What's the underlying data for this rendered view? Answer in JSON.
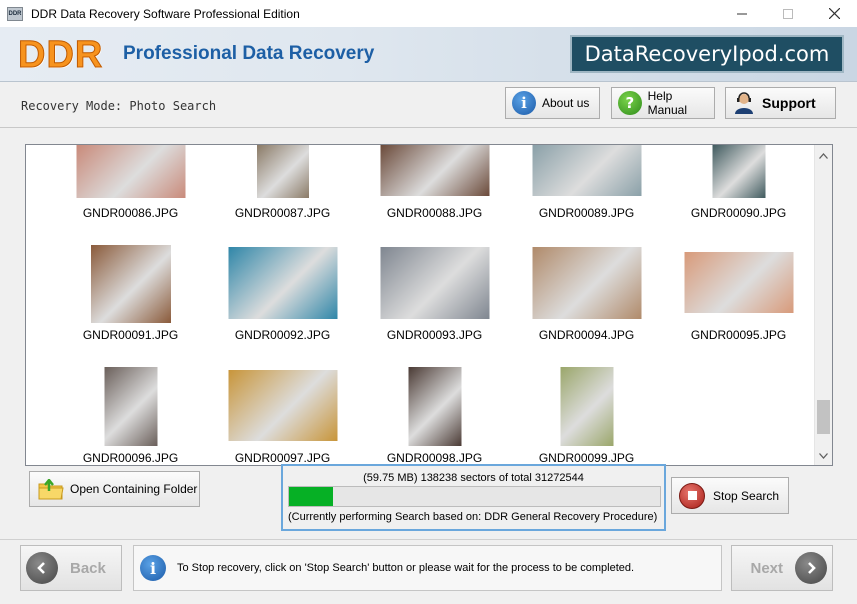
{
  "window": {
    "title": "DDR Data Recovery Software Professional Edition",
    "app_icon_text": "DDR"
  },
  "banner": {
    "logo": "DDR",
    "title": "Professional Data Recovery",
    "site": "DataRecoveryIpod.com"
  },
  "mode": {
    "label": "Recovery Mode: Photo Search"
  },
  "toolbar": {
    "about_label": "About us",
    "help_label": "Help Manual",
    "support_label": "Support"
  },
  "files": [
    {
      "name": "GNDR00086.JPG",
      "color": "#c98a7a"
    },
    {
      "name": "GNDR00087.JPG",
      "color": "#8a7a66"
    },
    {
      "name": "GNDR00088.JPG",
      "color": "#6b4a3a"
    },
    {
      "name": "GNDR00089.JPG",
      "color": "#8aa0a8"
    },
    {
      "name": "GNDR00090.JPG",
      "color": "#3f5a5e"
    },
    {
      "name": "GNDR00091.JPG",
      "color": "#8a5a3a"
    },
    {
      "name": "GNDR00092.JPG",
      "color": "#2f86a8"
    },
    {
      "name": "GNDR00093.JPG",
      "color": "#7f8690"
    },
    {
      "name": "GNDR00094.JPG",
      "color": "#b08a6a"
    },
    {
      "name": "GNDR00095.JPG",
      "color": "#d89a7a"
    },
    {
      "name": "GNDR00096.JPG",
      "color": "#6a5f5a"
    },
    {
      "name": "GNDR00097.JPG",
      "color": "#c8953a"
    },
    {
      "name": "GNDR00098.JPG",
      "color": "#4a3a34"
    },
    {
      "name": "GNDR00099.JPG",
      "color": "#9aa66a"
    }
  ],
  "open_folder_label": "Open Containing Folder",
  "progress": {
    "text": "(59.75 MB) 138238  sectors  of  total 31272544",
    "fraction": 0.118,
    "status": "(Currently performing Search based on:  DDR General Recovery Procedure)"
  },
  "stop_label": "Stop Search",
  "footer": {
    "back_label": "Back",
    "next_label": "Next",
    "info": "To Stop recovery, click on 'Stop Search' button or please wait for the process to be completed."
  }
}
